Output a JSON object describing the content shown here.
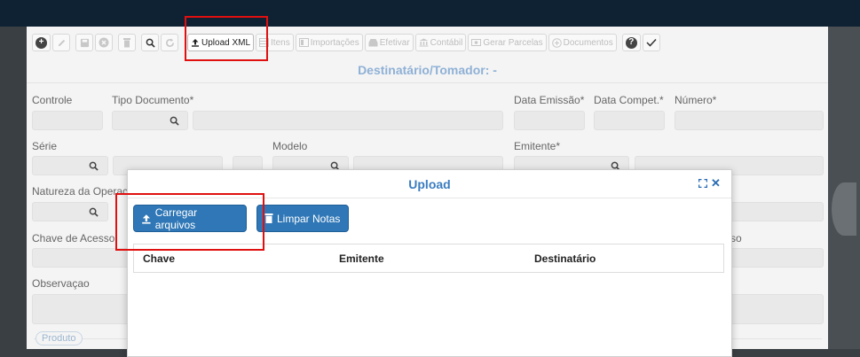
{
  "toolbar": {
    "upload_xml": "Upload XML",
    "itens": "Itens",
    "importacoes": "Importações",
    "efetivar": "Efetivar",
    "contabil": "Contábil",
    "gerar_parcelas": "Gerar Parcelas",
    "documentos": "Documentos",
    "help": "?"
  },
  "form": {
    "title": "Destinatário/Tomador: -",
    "labels": {
      "controle": "Controle",
      "tipo_documento": "Tipo Documento*",
      "data_emissao": "Data Emissão*",
      "data_compet": "Data Compet.*",
      "numero": "Número*",
      "serie": "Série",
      "modelo": "Modelo",
      "emitente": "Emitente*",
      "natureza": "Natureza da Operac",
      "chave_acesso": "Chave de Acesso",
      "acesso_partial": "so",
      "observacao": "Observaçao"
    },
    "produto_tab": "Produto"
  },
  "modal": {
    "title": "Upload",
    "carregar": "Carregar arquivos",
    "limpar": "Limpar Notas",
    "columns": [
      "Chave",
      "Emitente",
      "Destinatário"
    ]
  },
  "colors": {
    "accent": "#2f77b6",
    "highlight": "#e01010",
    "topbar": "#0e2233"
  }
}
